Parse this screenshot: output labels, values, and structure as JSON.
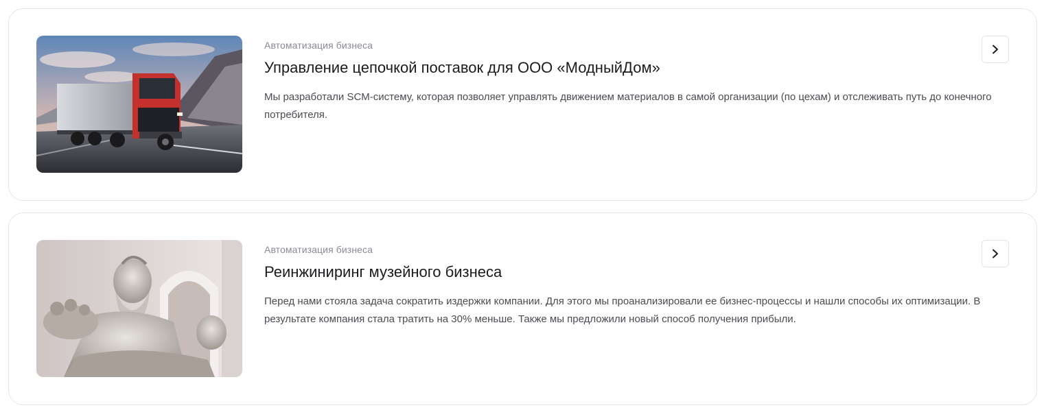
{
  "cases": [
    {
      "category": "Автоматизация бизнеса",
      "title": "Управление цепочкой поставок для ООО «МодныйДом»",
      "description": "Мы разработали SCM-систему, которая позволяет управлять движением материалов в самой организации (по цехам) и отслеживать путь до конечного потребителя.",
      "image_icon": "truck-photo",
      "action_icon": "chevron-right-icon"
    },
    {
      "category": "Автоматизация бизнеса",
      "title": "Реинжиниринг музейного бизнеса",
      "description": "Перед нами стояла задача сократить издержки компании. Для этого мы проанализировали ее бизнес-процессы и нашли способы их оптимизации. В результате компания стала тратить на 30% меньше. Также мы предложили новый способ получения прибыли.",
      "image_icon": "statue-photo",
      "action_icon": "chevron-right-icon"
    }
  ],
  "colors": {
    "border": "#e6e6e9",
    "category": "#8a8a93",
    "title": "#1b1b1f",
    "text": "#4b4b52"
  }
}
